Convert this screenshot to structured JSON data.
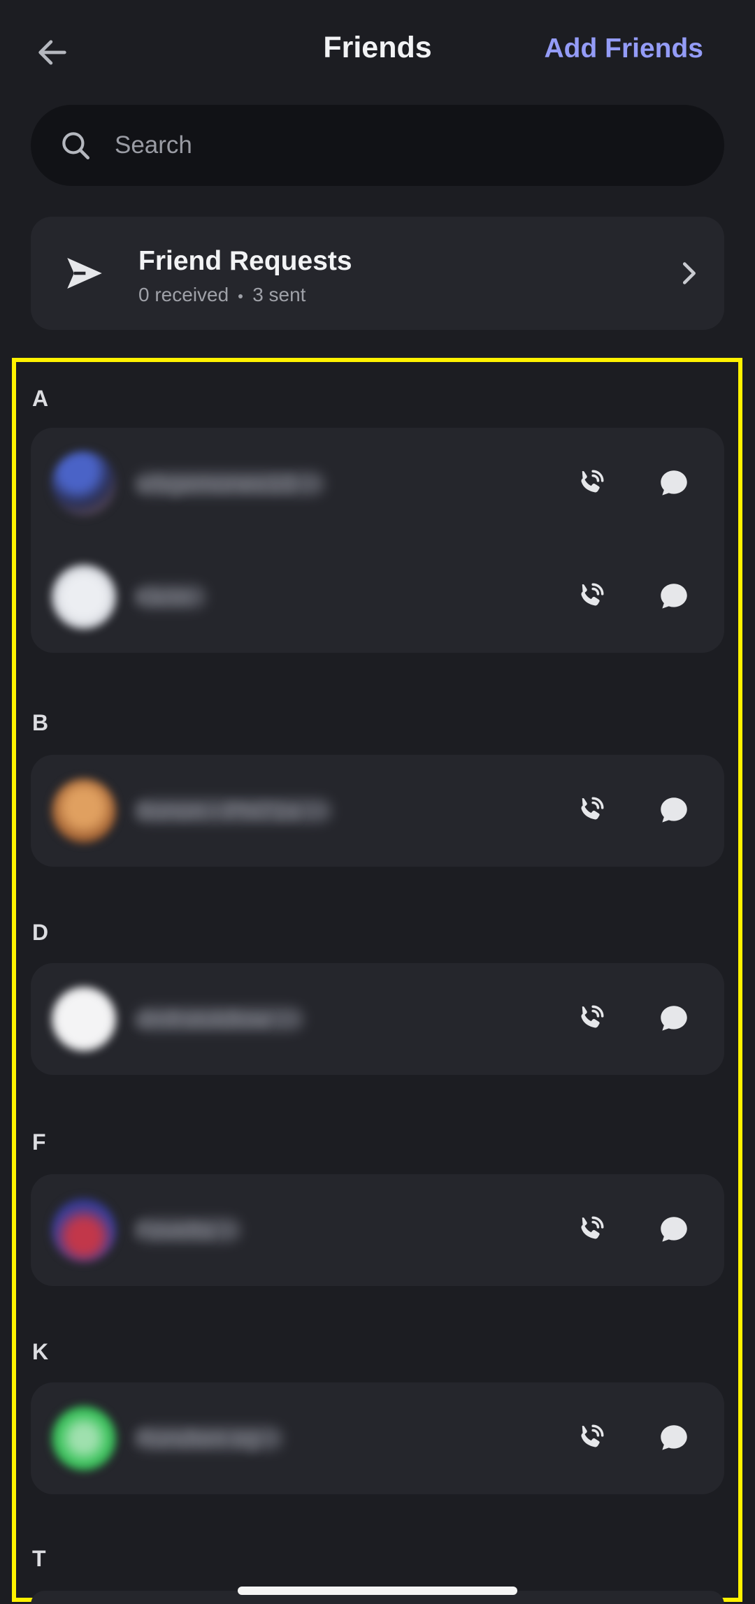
{
  "header": {
    "title": "Friends",
    "add_friends_label": "Add Friends",
    "back_icon": "arrow-left-icon"
  },
  "search": {
    "placeholder": "Search",
    "value": ""
  },
  "friend_requests": {
    "title": "Friend Requests",
    "received": "0 received",
    "sent": "3 sent"
  },
  "sections": [
    {
      "letter": "A",
      "friends": [
        {
          "name": "srbgemoneo10",
          "avatar_color": "#3b4fa8"
        },
        {
          "name": "Kkrin",
          "avatar_color": "#c9ccd4"
        }
      ]
    },
    {
      "letter": "B",
      "friends": [
        {
          "name": "Bonon - Phl71s",
          "avatar_color": "#c07a3c"
        }
      ]
    },
    {
      "letter": "D",
      "friends": [
        {
          "name": "dmfrstoldlow",
          "avatar_color": "#e4e4e6"
        }
      ]
    },
    {
      "letter": "F",
      "friends": [
        {
          "name": "Fovelts",
          "avatar_color": "#b23a4a"
        }
      ]
    },
    {
      "letter": "K",
      "friends": [
        {
          "name": "Rondten og",
          "avatar_color": "#3fc45f"
        }
      ]
    },
    {
      "letter": "T",
      "friends": []
    }
  ],
  "colors": {
    "background": "#1c1d22",
    "card": "#25262c",
    "accent": "#949cf7",
    "highlight": "#fff200"
  }
}
